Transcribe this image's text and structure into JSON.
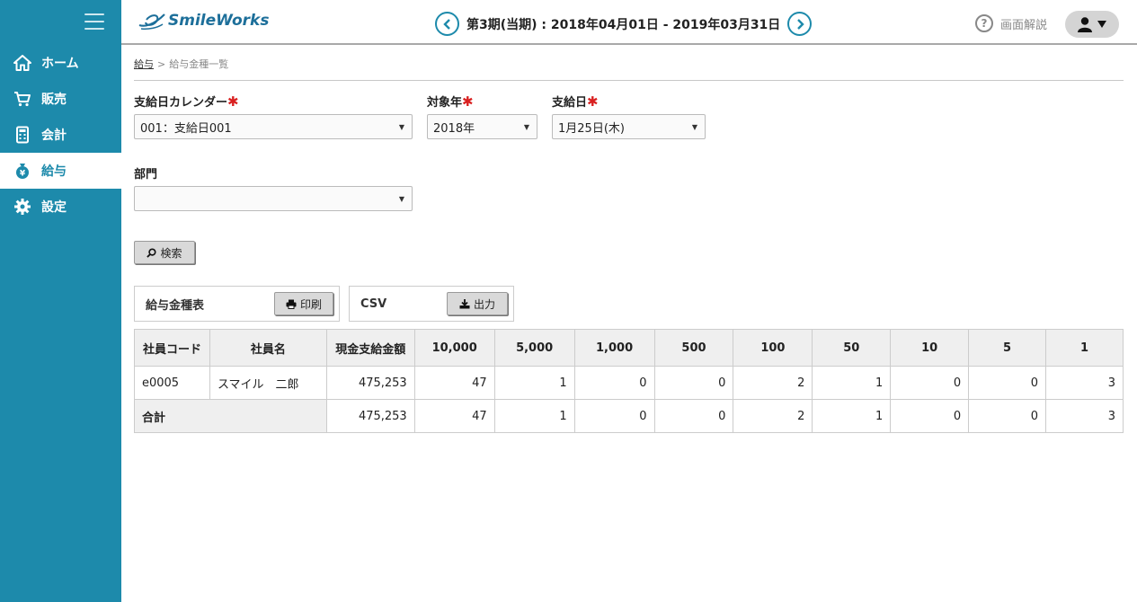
{
  "app": {
    "logo": "SmileWorks"
  },
  "header": {
    "period": "第3期(当期) : 2018年04月01日 - 2019年03月31日",
    "help_label": "画面解説"
  },
  "sidebar": {
    "items": [
      {
        "label": "ホーム",
        "icon": "home-icon"
      },
      {
        "label": "販売",
        "icon": "cart-icon"
      },
      {
        "label": "会計",
        "icon": "calculator-icon"
      },
      {
        "label": "給与",
        "icon": "money-bag-icon"
      },
      {
        "label": "設定",
        "icon": "gear-icon"
      }
    ],
    "active": "給与"
  },
  "breadcrumb": {
    "parent": "給与",
    "separator": ">",
    "current": "給与金種一覧"
  },
  "form": {
    "calendar_label": "支給日カレンダー",
    "calendar_value": "001：支給日001",
    "year_label": "対象年",
    "year_value": "2018年",
    "payday_label": "支給日",
    "payday_value": "1月25日(木)",
    "dept_label": "部門",
    "dept_value": "",
    "required_mark": "✱",
    "search_label": "検索"
  },
  "actions": {
    "report_label": "給与金種表",
    "print_label": "印刷",
    "csv_label": "CSV",
    "export_label": "出力"
  },
  "table": {
    "headers": [
      "社員コード",
      "社員名",
      "現金支給金額",
      "10,000",
      "5,000",
      "1,000",
      "500",
      "100",
      "50",
      "10",
      "5",
      "1"
    ],
    "rows": [
      [
        "e0005",
        "スマイル　二郎",
        "475,253",
        "47",
        "1",
        "0",
        "0",
        "2",
        "1",
        "0",
        "0",
        "3"
      ]
    ],
    "total": {
      "label": "合計",
      "values": [
        "475,253",
        "47",
        "1",
        "0",
        "0",
        "2",
        "1",
        "0",
        "0",
        "3"
      ]
    }
  },
  "colors": {
    "primary": "#1d8aab",
    "required": "#d92020",
    "logo": "#1d6f9a"
  }
}
